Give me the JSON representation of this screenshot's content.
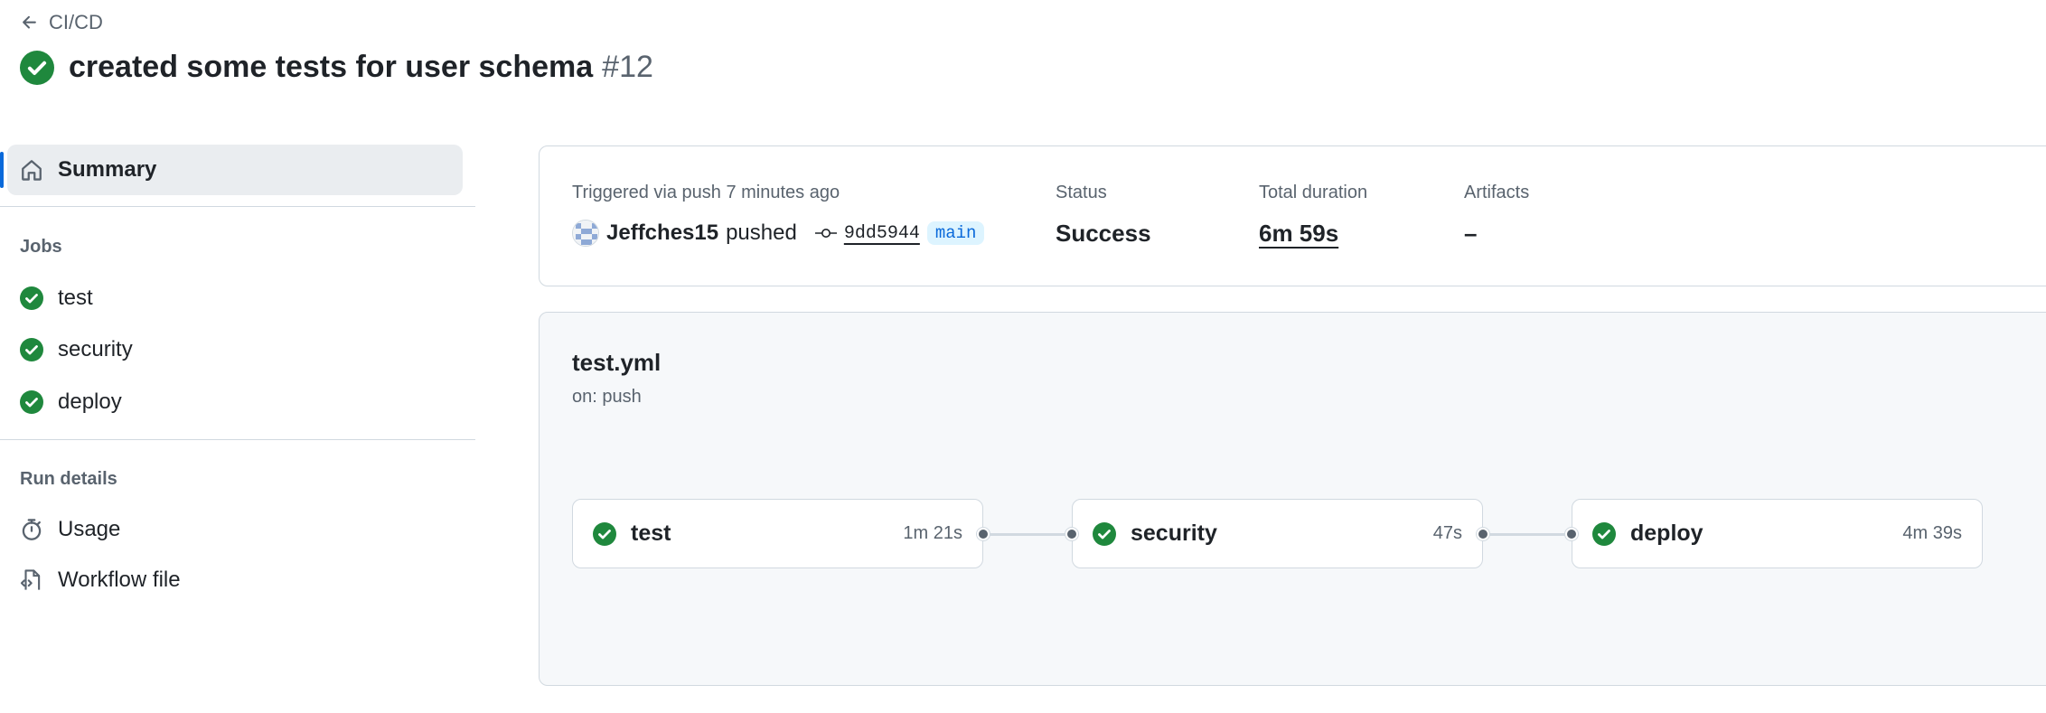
{
  "header": {
    "back_label": "CI/CD",
    "title": "created some tests for user schema",
    "run_number": "#12"
  },
  "sidebar": {
    "summary_label": "Summary",
    "jobs_heading": "Jobs",
    "jobs": [
      {
        "label": "test"
      },
      {
        "label": "security"
      },
      {
        "label": "deploy"
      }
    ],
    "run_details_heading": "Run details",
    "details": [
      {
        "label": "Usage",
        "icon": "stopwatch-icon"
      },
      {
        "label": "Workflow file",
        "icon": "file-code-icon"
      }
    ]
  },
  "summary": {
    "trigger_label": "Triggered via push 7 minutes ago",
    "actor": "Jeffches15",
    "action": "pushed",
    "commit": "9dd5944",
    "branch": "main",
    "status_label": "Status",
    "status_value": "Success",
    "duration_label": "Total duration",
    "duration_value": "6m 59s",
    "artifacts_label": "Artifacts",
    "artifacts_value": "–"
  },
  "workflow": {
    "file": "test.yml",
    "trigger": "on: push",
    "jobs": [
      {
        "name": "test",
        "duration": "1m 21s"
      },
      {
        "name": "security",
        "duration": "47s"
      },
      {
        "name": "deploy",
        "duration": "4m 39s"
      }
    ]
  },
  "colors": {
    "success": "#1f883d",
    "accent": "#0969da",
    "muted_text": "#59636e",
    "border": "#d1d9e0"
  }
}
